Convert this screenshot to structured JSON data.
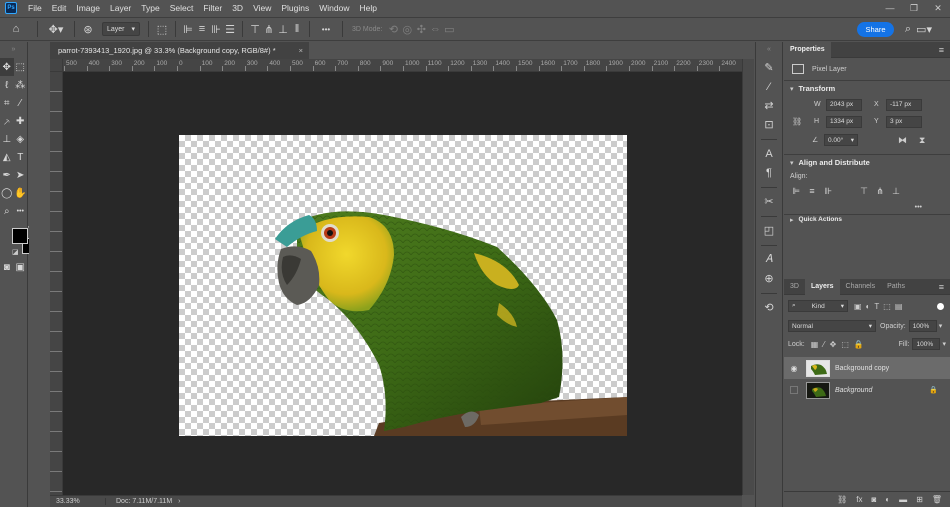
{
  "app": {
    "logo_text": "Ps"
  },
  "menu": [
    "File",
    "Edit",
    "Image",
    "Layer",
    "Type",
    "Select",
    "Filter",
    "3D",
    "View",
    "Plugins",
    "Window",
    "Help"
  ],
  "window_controls": [
    "—",
    "❐",
    "✕"
  ],
  "options_bar": {
    "auto_select_value": "Layer",
    "mode_3d_label": "3D Mode:",
    "more_label": "•••",
    "share_label": "Share"
  },
  "document": {
    "tab_title": "parrot-7393413_1920.jpg @ 33.3% (Background copy, RGB/8#) *",
    "close_label": "×",
    "zoom": "33.33%",
    "doc_info": "Doc: 7.11M/7.11M"
  },
  "ruler_labels": [
    "500",
    "400",
    "300",
    "200",
    "100",
    "0",
    "100",
    "200",
    "300",
    "400",
    "500",
    "600",
    "700",
    "800",
    "900",
    "1000",
    "1100",
    "1200",
    "1300",
    "1400",
    "1500",
    "1600",
    "1700",
    "1800",
    "1900",
    "2000",
    "2100",
    "2200",
    "2300",
    "2400"
  ],
  "properties": {
    "tab_label": "Properties",
    "layer_kind": "Pixel Layer",
    "transform_title": "Transform",
    "w_label": "W",
    "w_value": "2043 px",
    "x_label": "X",
    "x_value": "-117 px",
    "h_label": "H",
    "h_value": "1334 px",
    "y_label": "Y",
    "y_value": "3 px",
    "angle_value": "0.00°",
    "align_title": "Align and Distribute",
    "align_label": "Align:",
    "more_label": "•••",
    "quick_actions_title": "Quick Actions"
  },
  "layers": {
    "tabs": [
      "3D",
      "Layers",
      "Channels",
      "Paths"
    ],
    "active_tab": "Layers",
    "kind_label": "Kind",
    "blend_mode": "Normal",
    "opacity_label": "Opacity:",
    "opacity_value": "100%",
    "lock_label": "Lock:",
    "fill_label": "Fill:",
    "fill_value": "100%",
    "items": [
      {
        "name": "Background copy",
        "visible": true,
        "selected": true
      },
      {
        "name": "Background",
        "visible": false,
        "selected": false,
        "locked": true
      }
    ]
  },
  "colors": {
    "accent": "#1473e6",
    "panel_bg": "#535353",
    "pasteboard": "#282828",
    "selected_layer": "#6b6b6b"
  }
}
